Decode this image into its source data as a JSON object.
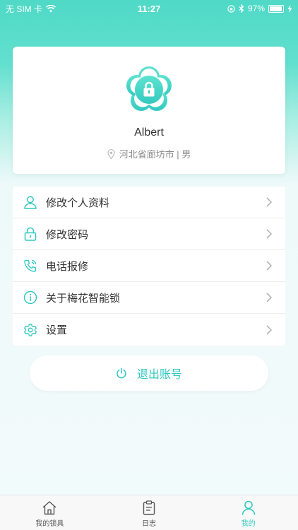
{
  "status_bar": {
    "carrier": "无 SIM 卡",
    "time": "11:27",
    "battery_text": "97%",
    "battery_level": 0.97
  },
  "profile": {
    "name": "Albert",
    "location": "河北省廊坊市 | 男"
  },
  "menu": {
    "items": [
      {
        "label": "修改个人资料",
        "icon": "user-icon"
      },
      {
        "label": "修改密码",
        "icon": "lock-icon"
      },
      {
        "label": "电话报修",
        "icon": "phone-icon"
      },
      {
        "label": "关于梅花智能锁",
        "icon": "info-icon"
      },
      {
        "label": "设置",
        "icon": "gear-icon"
      }
    ]
  },
  "logout": {
    "label": "退出账号"
  },
  "tabbar": {
    "tabs": [
      {
        "label": "我的锁具",
        "icon": "home-icon",
        "active": false
      },
      {
        "label": "日志",
        "icon": "clipboard-icon",
        "active": false
      },
      {
        "label": "我的",
        "icon": "person-icon",
        "active": true
      }
    ]
  },
  "colors": {
    "accent": "#31c9c0",
    "header_gradient_top": "#4fd9c6",
    "text_primary": "#333333",
    "text_secondary": "#8a8a8a"
  }
}
